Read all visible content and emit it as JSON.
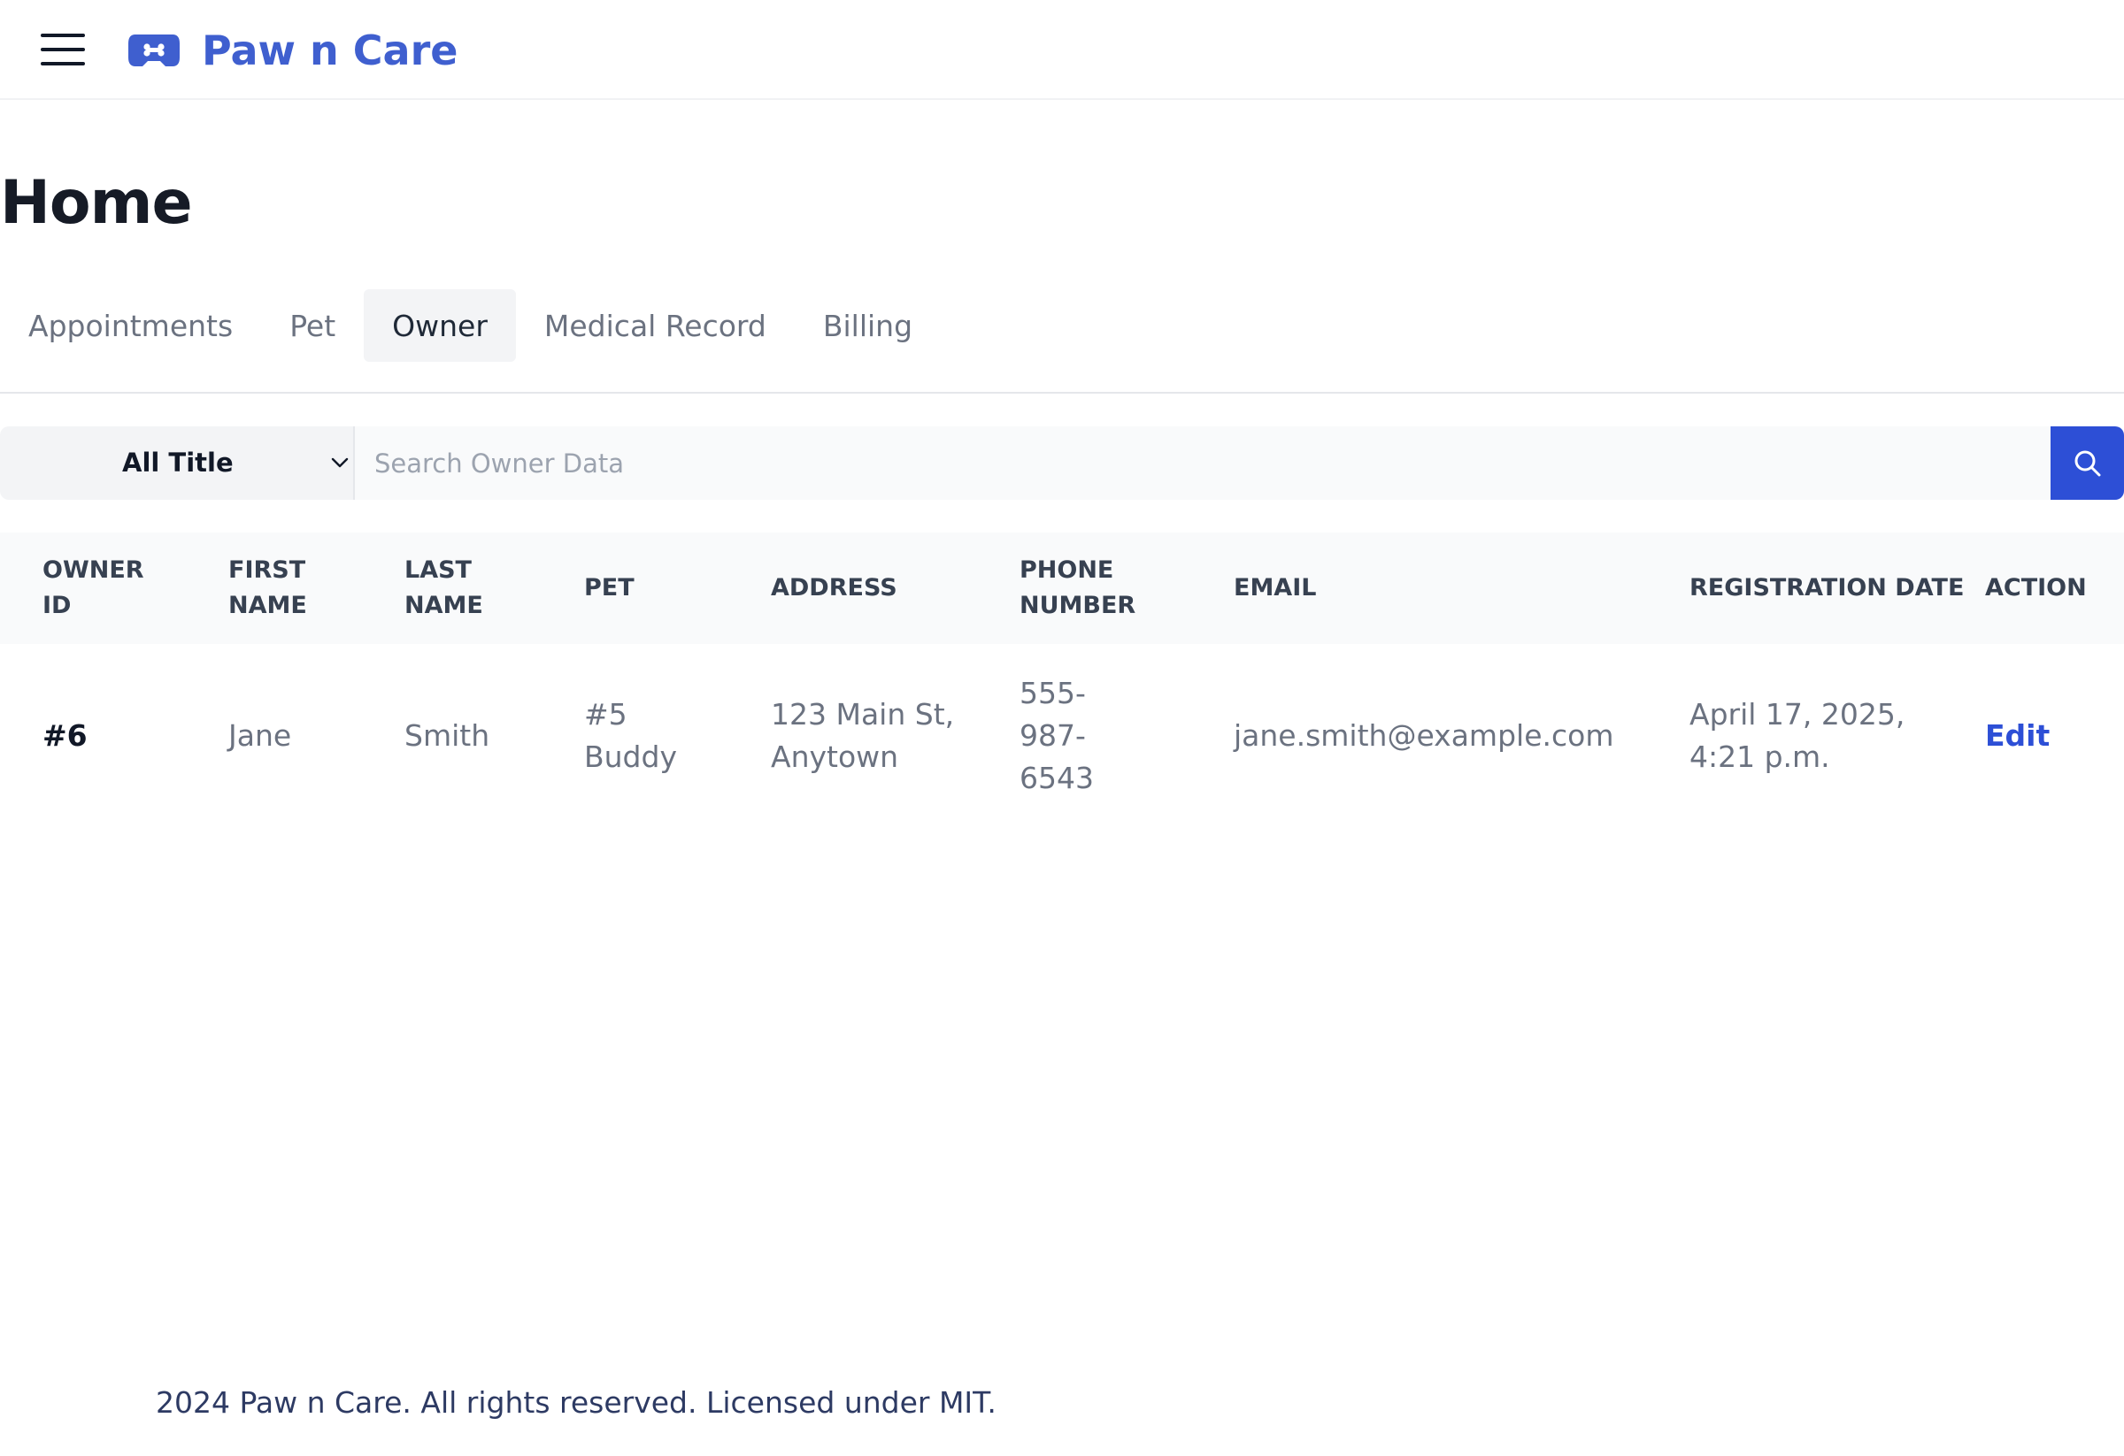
{
  "header": {
    "brand_name": "Paw n Care",
    "brand_color": "#3f5fcf",
    "menu_icon": "hamburger-menu-icon",
    "logo_icon": "paw-bone-logo-icon"
  },
  "page": {
    "title": "Home"
  },
  "tabs": [
    {
      "label": "Appointments",
      "active": false
    },
    {
      "label": "Pet",
      "active": false
    },
    {
      "label": "Owner",
      "active": true
    },
    {
      "label": "Medical Record",
      "active": false
    },
    {
      "label": "Billing",
      "active": false
    }
  ],
  "search": {
    "filter_selected": "All Title",
    "placeholder": "Search Owner Data",
    "value": "",
    "button_icon": "search-icon",
    "button_color": "#2d4fd6"
  },
  "table": {
    "columns": [
      "OWNER ID",
      "FIRST NAME",
      "LAST NAME",
      "PET",
      "ADDRESS",
      "PHONE NUMBER",
      "EMAIL",
      "REGISTRATION DATE",
      "ACTION"
    ],
    "rows": [
      {
        "owner_id": "#6",
        "first_name": "Jane",
        "last_name": "Smith",
        "pet": "#5 Buddy",
        "address": "123 Main St, Anytown",
        "phone": "555-987-6543",
        "email": "jane.smith@example.com",
        "registration_date": "April 17, 2025, 4:21 p.m.",
        "action": "Edit"
      }
    ]
  },
  "footer": {
    "text": "2024 Paw n Care. All rights reserved. Licensed under MIT."
  }
}
